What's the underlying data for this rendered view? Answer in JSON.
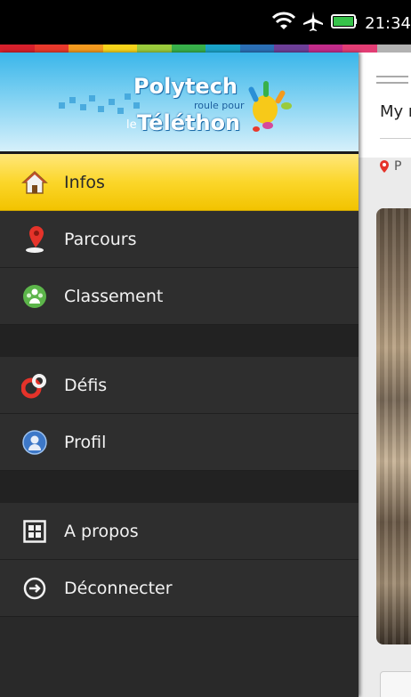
{
  "status_bar": {
    "time": "21:34",
    "icons": [
      "wifi-icon",
      "airplane-icon",
      "battery-icon"
    ]
  },
  "colors": {
    "stripe": [
      "#d6202c",
      "#e8392c",
      "#f39a1f",
      "#f6d31b",
      "#9acb3c",
      "#38b04a",
      "#1aa3c8",
      "#2b6fb5",
      "#6d3f98",
      "#c22c8a",
      "#e23d74",
      "#b2b2b2"
    ],
    "active_item": "#fbd62a",
    "drawer_bg": "#2e2e2e"
  },
  "banner": {
    "brand_line1": "Polytech",
    "brand_sub": "roule pour",
    "brand_le": "le",
    "brand_line2": "Téléthon"
  },
  "menu": {
    "group1": [
      {
        "label": "Infos",
        "icon": "home-icon",
        "active": true
      },
      {
        "label": "Parcours",
        "icon": "map-pin-icon",
        "active": false
      },
      {
        "label": "Classement",
        "icon": "people-icon",
        "active": false
      }
    ],
    "group2": [
      {
        "label": "Défis",
        "icon": "rings-icon",
        "active": false
      },
      {
        "label": "Profil",
        "icon": "user-icon",
        "active": false
      }
    ],
    "group3": [
      {
        "label": "A propos",
        "icon": "grid-icon",
        "active": false
      },
      {
        "label": "Déconnecter",
        "icon": "logout-icon",
        "active": false
      }
    ]
  },
  "content": {
    "title_fragment": "My r",
    "location_fragment": "P"
  }
}
